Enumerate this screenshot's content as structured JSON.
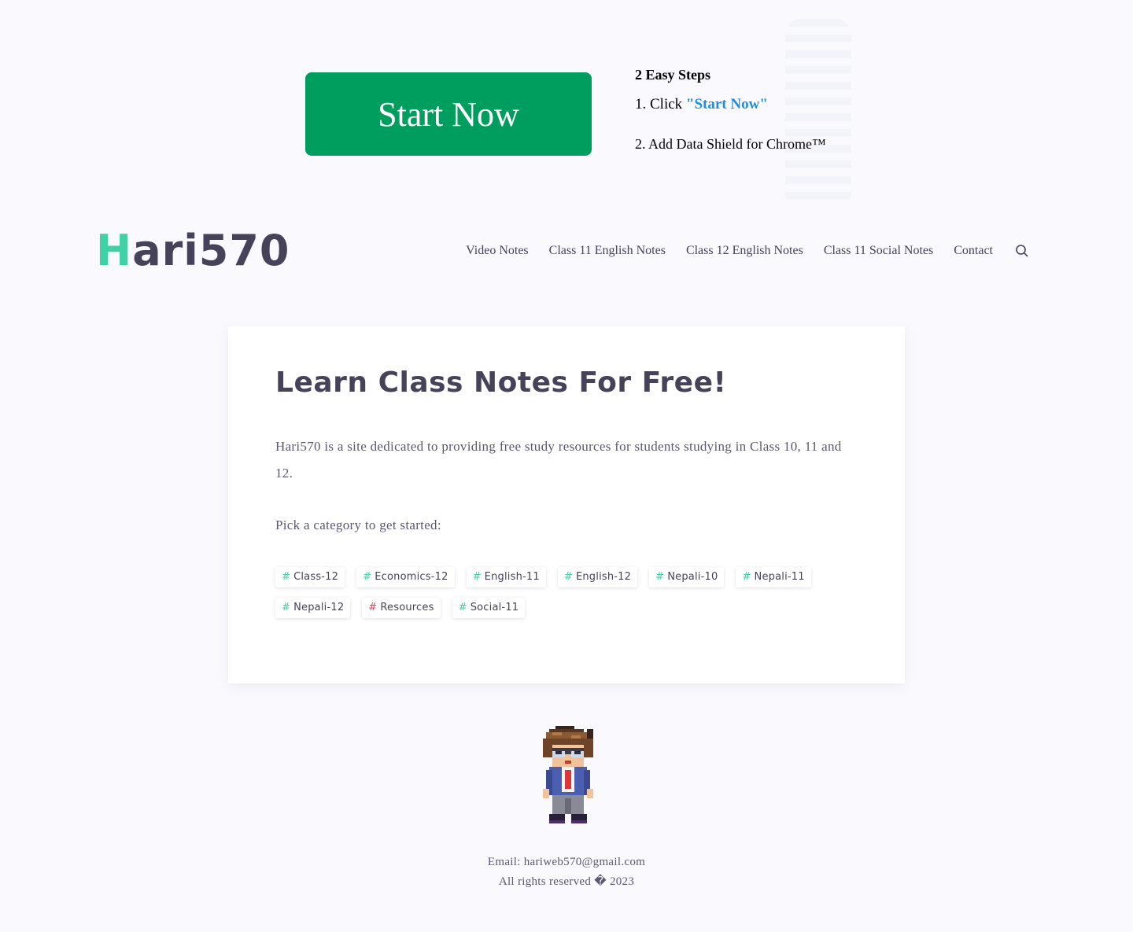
{
  "ad": {
    "button_label": "Start Now",
    "heading": "2 Easy Steps",
    "step1_prefix": "1. Click ",
    "step1_highlight": "\"Start Now\"",
    "step2": "2. Add Data Shield for Chrome™",
    "colors": {
      "button": "#009e5e",
      "highlight": "#1e8fe0"
    }
  },
  "header": {
    "logo_first": "H",
    "logo_rest": "ari570",
    "nav": [
      {
        "label": "Video Notes"
      },
      {
        "label": "Class 11 English Notes"
      },
      {
        "label": "Class 12 English Notes"
      },
      {
        "label": "Class 11 Social Notes"
      },
      {
        "label": "Contact"
      }
    ],
    "search_icon": "search-icon"
  },
  "main": {
    "title": "Learn Class Notes For Free!",
    "intro": "Hari570 is a site dedicated to providing free study resources for students studying in Class 10, 11 and 12.",
    "pick": "Pick a category to get started:",
    "tags": [
      {
        "label": "Class-12",
        "hash": "#",
        "color": "#40d1a6"
      },
      {
        "label": "Economics-12",
        "hash": "#",
        "color": "#40d1a6"
      },
      {
        "label": "English-11",
        "hash": "#",
        "color": "#40d1a6"
      },
      {
        "label": "English-12",
        "hash": "#",
        "color": "#40d1a6"
      },
      {
        "label": "Nepali-10",
        "hash": "#",
        "color": "#40d1a6"
      },
      {
        "label": "Nepali-11",
        "hash": "#",
        "color": "#40d1a6"
      },
      {
        "label": "Nepali-12",
        "hash": "#",
        "color": "#40d1a6"
      },
      {
        "label": "Resources",
        "hash": "#",
        "color": "#e8475a"
      },
      {
        "label": "Social-11",
        "hash": "#",
        "color": "#40d1a6"
      }
    ]
  },
  "footer": {
    "email": "Email: hariweb570@gmail.com",
    "rights": "All rights reserved � 2023",
    "avatar_icon": "pixel-character"
  },
  "colors": {
    "accent": "#40d1a6",
    "text": "#45425a",
    "background": "#f9f9fe"
  }
}
